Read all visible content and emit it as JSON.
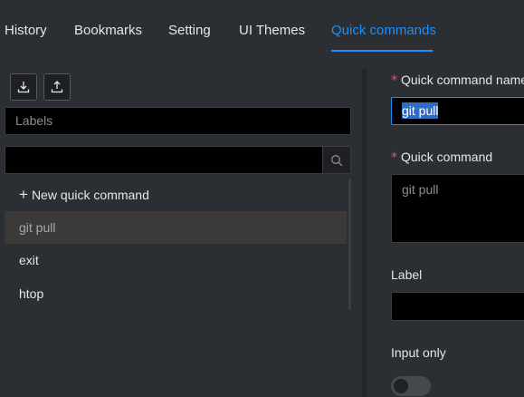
{
  "tabs": [
    {
      "label": "History"
    },
    {
      "label": "Bookmarks"
    },
    {
      "label": "Setting"
    },
    {
      "label": "UI Themes"
    },
    {
      "label": "Quick commands",
      "active": true
    }
  ],
  "toolbar": {
    "import_icon": "download-icon",
    "export_icon": "upload-icon"
  },
  "labels_filter": {
    "placeholder": "Labels"
  },
  "search": {
    "value": "",
    "icon": "search-icon"
  },
  "list": {
    "new_label": "New quick command",
    "items": [
      {
        "label": "git pull",
        "selected": true
      },
      {
        "label": "exit"
      },
      {
        "label": "htop"
      }
    ]
  },
  "form": {
    "required_mark": "*",
    "name_label": "Quick command name",
    "name_value": "git pull",
    "command_label": "Quick command",
    "command_value": "git pull",
    "label_label": "Label",
    "label_value": "",
    "input_only_label": "Input only",
    "input_only_on": false
  },
  "colors": {
    "accent": "#1890ff",
    "required": "#ff4d4f",
    "background": "#2b2e33"
  }
}
